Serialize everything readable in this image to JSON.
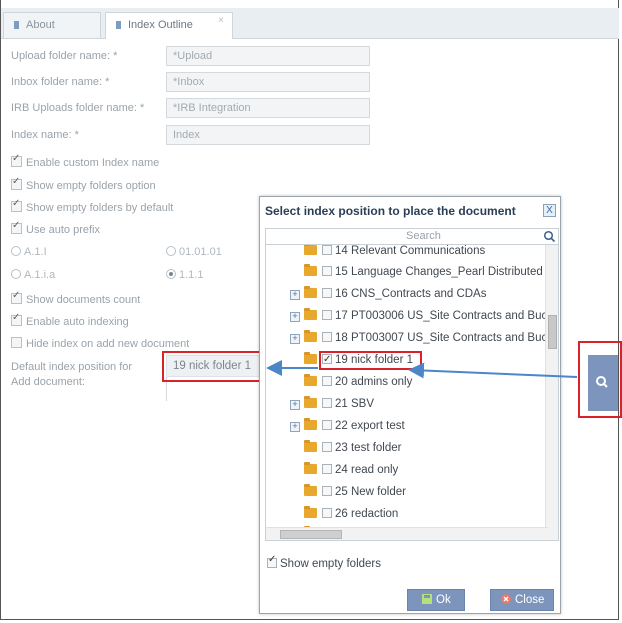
{
  "tabs": [
    {
      "label": "About",
      "active": false
    },
    {
      "label": "Index Outline",
      "active": true,
      "close": "×"
    }
  ],
  "form": {
    "upload_label": "Upload folder name: *",
    "upload_value": "*Upload",
    "inbox_label": "Inbox folder name: *",
    "inbox_value": "*Inbox",
    "irb_label": "IRB Uploads folder name: *",
    "irb_value": "*IRB Integration",
    "index_label": "Index name: *",
    "index_value": "Index",
    "enable_custom_index": "Enable custom Index name",
    "show_empty_option": "Show empty folders option",
    "show_empty_default": "Show empty folders by default",
    "use_auto_prefix": "Use auto prefix",
    "radio_a11": "A.1.I",
    "radio_010101": "01.01.01",
    "radio_a1ia": "A.1.i.a",
    "radio_111": "1.1.1",
    "show_docs_count": "Show documents count",
    "enable_auto_indexing": "Enable auto indexing",
    "hide_index": "Hide index on add new document",
    "default_pos_label_1": "Default index position for",
    "default_pos_label_2": "Add document:",
    "default_pos_value": "19 nick folder 1"
  },
  "dialog": {
    "title": "Select index position to place the document",
    "close": "X",
    "search_placeholder": "Search",
    "tree": [
      {
        "label": "14 Relevant Communications",
        "expandable": false,
        "checked": false
      },
      {
        "label": "15 Language Changes_Pearl Distributed",
        "expandable": false,
        "checked": false
      },
      {
        "label": "16 CNS_Contracts and CDAs",
        "expandable": true,
        "checked": false
      },
      {
        "label": "17 PT003006 US_Site Contracts and Buc",
        "expandable": true,
        "checked": false
      },
      {
        "label": "18 PT003007 US_Site Contracts and Buc",
        "expandable": true,
        "checked": false
      },
      {
        "label": "19 nick folder 1",
        "expandable": false,
        "checked": true
      },
      {
        "label": "20 admins only",
        "expandable": false,
        "checked": false
      },
      {
        "label": "21 SBV",
        "expandable": true,
        "checked": false
      },
      {
        "label": "22 export test",
        "expandable": true,
        "checked": false
      },
      {
        "label": "23 test folder",
        "expandable": false,
        "checked": false
      },
      {
        "label": "24 read only",
        "expandable": false,
        "checked": false
      },
      {
        "label": "25 New folder",
        "expandable": false,
        "checked": false
      },
      {
        "label": "26 redaction",
        "expandable": false,
        "checked": false
      }
    ],
    "show_empty_folders": "Show empty folders",
    "ok_label": "Ok",
    "close_label": "Close"
  },
  "colors": {
    "accent": "#7d95bc",
    "highlight": "#d8232a",
    "arrow": "#4a86c8",
    "folder": "#e8a72d"
  }
}
